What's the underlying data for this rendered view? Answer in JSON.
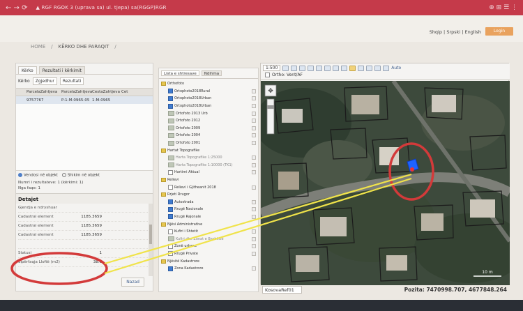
{
  "browser": {
    "nav_glyphs": "←  →  ⟳",
    "url": "▲ RGF RGOK 3 (uprava sa) ul. tjepa) sa(RGGP)RGR",
    "right_glyphs": "⊕  ⊞  ☰  ⋮"
  },
  "site": {
    "languages": "Shqip | Srpski | English",
    "login_label": "Login"
  },
  "breadcrumb": {
    "home": "HOME",
    "separator": "/",
    "current": "KËRKO DHE PARAQIT",
    "trailing": "/"
  },
  "left_panel": {
    "tabs": [
      "Kërko",
      "Rezultati i kërkimit"
    ],
    "search_label": "Kërko",
    "search_select": "Zgjedhur",
    "search_field": "Rezultati",
    "grid_columns": [
      "",
      "ParcelaZahtjeva",
      "ParcelaZahtjeva",
      "CestaZahtjeva",
      "Cet"
    ],
    "grid_rows": [
      {
        "check": "",
        "c1": "9757767",
        "c2": "P-1-M-0965-05",
        "c3": "1-M-0965",
        "c4": ""
      }
    ],
    "radio_options": [
      "Vendosi në objekt",
      "Shikim në objekt"
    ],
    "info_lines": [
      "Numri i rezultateve: 1 (kërkimi: 1)",
      "Nga faqe: 1"
    ],
    "details_title": "Detajet",
    "details_rows": [
      {
        "label": "Gjendja e ndryshuar",
        "value": ""
      },
      {
        "label": "Cadastral element",
        "value": "1185.3659"
      },
      {
        "label": "Cadastral element",
        "value": "1185.3659"
      },
      {
        "label": "Cadastral element",
        "value": "1185.3659"
      },
      {
        "label": "",
        "value": ""
      },
      {
        "label": "Statusi",
        "value": "1"
      },
      {
        "label": "Sipërfaqja Lloftë (m2)",
        "value": "38.6"
      }
    ],
    "back_button": "Nazad"
  },
  "layers_panel": {
    "tabs": [
      "Lista e shtresave",
      "Ndihma"
    ],
    "nodes": [
      {
        "level": 0,
        "kind": "folder",
        "label": "Orthofoto",
        "gray": false
      },
      {
        "level": 1,
        "kind": "check-on",
        "label": "Ortophoto2018Rural",
        "gray": false
      },
      {
        "level": 1,
        "kind": "check-on",
        "label": "Ortophoto2018Urban",
        "gray": false
      },
      {
        "level": 1,
        "kind": "check-on",
        "label": "Ortophoto2018Urban",
        "gray": false
      },
      {
        "level": 1,
        "kind": "thumb",
        "label": "Ortofoto 2013 Urb",
        "gray": false
      },
      {
        "level": 1,
        "kind": "thumb",
        "label": "Ortofoto 2012",
        "gray": false
      },
      {
        "level": 1,
        "kind": "thumb",
        "label": "Ortofoto 2009",
        "gray": false
      },
      {
        "level": 1,
        "kind": "thumb",
        "label": "Ortofoto 2004",
        "gray": false
      },
      {
        "level": 1,
        "kind": "thumb",
        "label": "Ortofoto 2001",
        "gray": false
      },
      {
        "level": 0,
        "kind": "folder",
        "label": "Hartat Topografike",
        "gray": false
      },
      {
        "level": 1,
        "kind": "thumb",
        "label": "Harta Topografike 1:25000",
        "gray": true
      },
      {
        "level": 1,
        "kind": "thumb",
        "label": "Harta Topografike 1:10000 (TK1)",
        "gray": true
      },
      {
        "level": 1,
        "kind": "check-off",
        "label": "Hartimi Aktual",
        "gray": false
      },
      {
        "level": 0,
        "kind": "folder",
        "label": "Relievi",
        "gray": false
      },
      {
        "level": 1,
        "kind": "check-off",
        "label": "Relievi i Gjitheanit 2018",
        "gray": false
      },
      {
        "level": 0,
        "kind": "folder",
        "label": "Rrjeti Rrugor",
        "gray": false
      },
      {
        "level": 1,
        "kind": "check-on",
        "label": "Autostrada",
        "gray": false
      },
      {
        "level": 1,
        "kind": "check-on",
        "label": "Rrugë Nacionale",
        "gray": false
      },
      {
        "level": 1,
        "kind": "check-on",
        "label": "Rrugë Rajonale",
        "gray": false
      },
      {
        "level": 0,
        "kind": "folder",
        "label": "Njësi Administrative",
        "gray": false
      },
      {
        "level": 1,
        "kind": "check-off",
        "label": "Kufiri i Shtetit",
        "gray": false
      },
      {
        "level": 1,
        "kind": "thumb",
        "label": "Kufiri dhe Zonat e Bashkisë",
        "gray": true
      },
      {
        "level": 1,
        "kind": "check-off",
        "label": "Zonë urbane",
        "gray": false
      },
      {
        "level": 1,
        "kind": "check-off",
        "label": "Rrugë Private",
        "gray": false
      },
      {
        "level": 0,
        "kind": "folder",
        "label": "Njësitë Kadastrore",
        "gray": false
      },
      {
        "level": 1,
        "kind": "check-on",
        "label": "Zona Kadastrore",
        "gray": false
      }
    ]
  },
  "map": {
    "scale_select": "1:500",
    "auto_label": "Auto",
    "toolbar_check_label": "Ortho: Vent/AF",
    "scale_bar_label": "10 m",
    "projection_select": "KosovaRef01",
    "position_text": "Pozita: 7470998.707, 4677848.264"
  },
  "colors": {
    "chrome": "#c53a4a",
    "login": "#e9a25e",
    "highlight_ring": "#d33a3a",
    "leader_line": "#f0e34a",
    "parcel_outline": "#1b1b1b",
    "selected_parcel": "#1f63ff"
  },
  "icons": {
    "map_nav": "pan-zoom-control-icon",
    "layer_folder": "folder-icon",
    "marker": "map-pin-icon"
  }
}
